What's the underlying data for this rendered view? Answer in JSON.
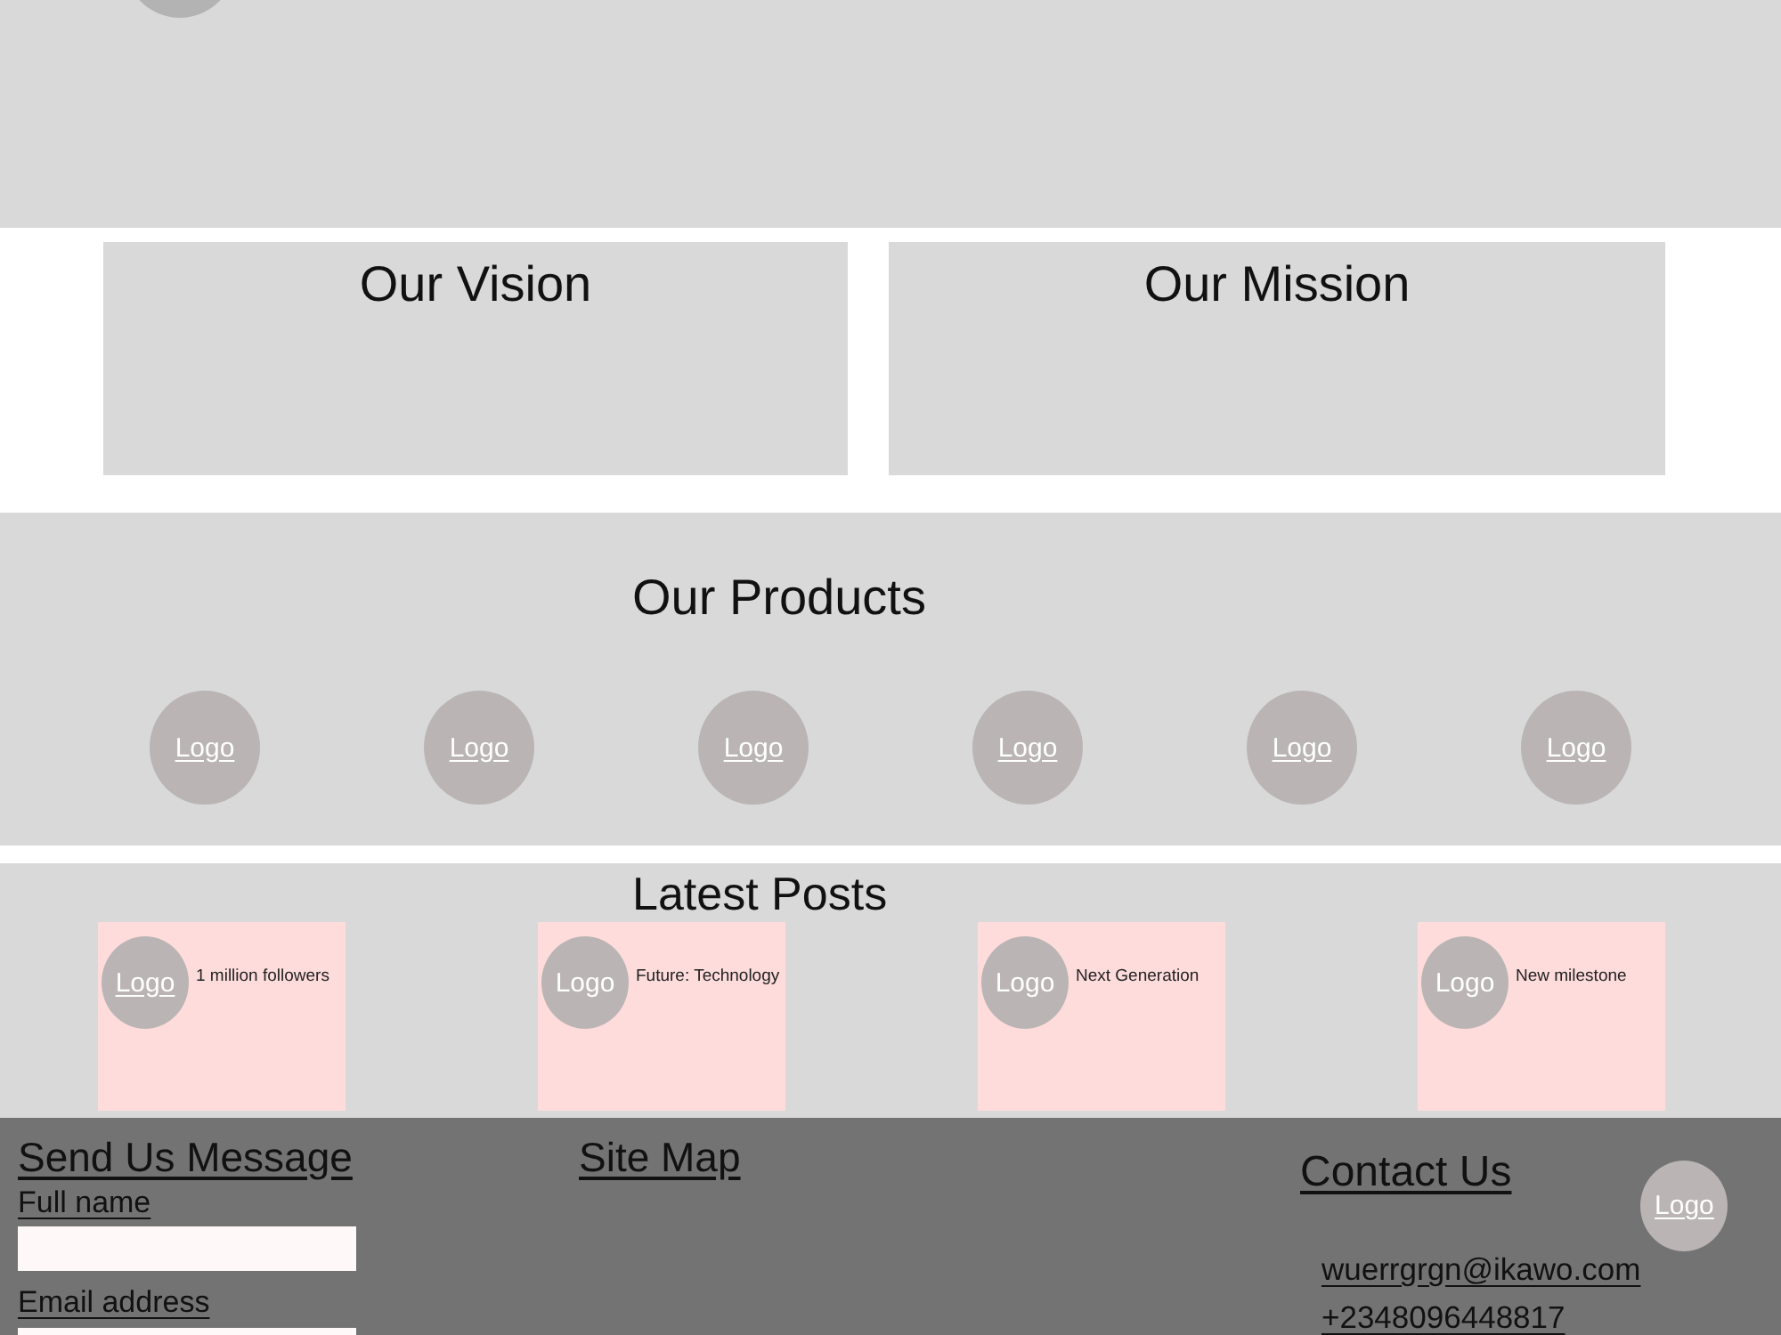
{
  "info_cards": [
    {
      "title": "Our Vision"
    },
    {
      "title": "Our Mission"
    }
  ],
  "products": {
    "title": "Our Products",
    "logos": [
      "Logo",
      "Logo",
      "Logo",
      "Logo",
      "Logo",
      "Logo"
    ]
  },
  "posts": {
    "title": "Latest Posts",
    "items": [
      {
        "logo": "Logo",
        "underlined": true,
        "title": "1 million followers"
      },
      {
        "logo": "Logo",
        "underlined": false,
        "title": "Future: Technology"
      },
      {
        "logo": "Logo",
        "underlined": false,
        "title": "Next Generation"
      },
      {
        "logo": "Logo",
        "underlined": false,
        "title": "New milestone"
      }
    ]
  },
  "footer": {
    "message_form": {
      "title": "Send Us Message",
      "fields": [
        {
          "label": "Full name"
        },
        {
          "label": "Email address"
        }
      ]
    },
    "site_map": {
      "title": "Site Map"
    },
    "contact": {
      "title": "Contact Us",
      "logo": "Logo",
      "email": "wuerrgrgn@ikawo.com",
      "phone": "+2348096448817"
    }
  }
}
